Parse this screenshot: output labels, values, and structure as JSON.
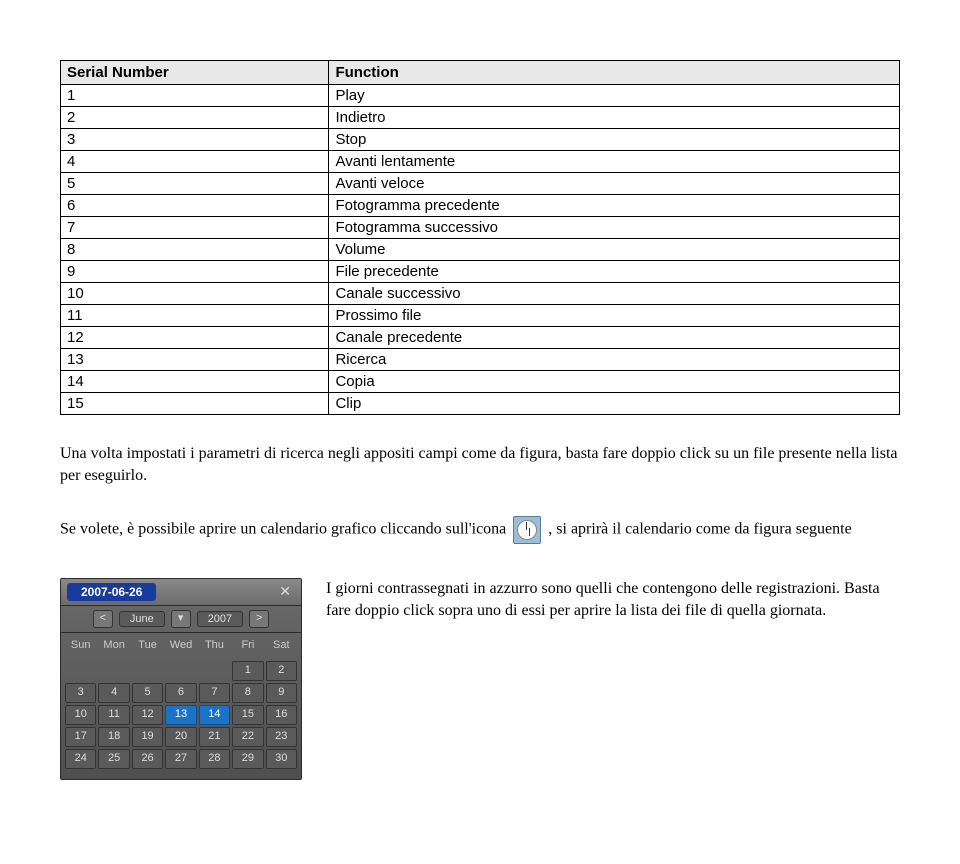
{
  "table": {
    "headers": {
      "serial": "Serial Number",
      "function": "Function"
    },
    "rows": [
      {
        "sn": "1",
        "fn": "Play"
      },
      {
        "sn": "2",
        "fn": "Indietro"
      },
      {
        "sn": "3",
        "fn": "Stop"
      },
      {
        "sn": "4",
        "fn": "Avanti lentamente"
      },
      {
        "sn": "5",
        "fn": "Avanti veloce"
      },
      {
        "sn": "6",
        "fn": "Fotogramma precedente"
      },
      {
        "sn": "7",
        "fn": "Fotogramma successivo"
      },
      {
        "sn": "8",
        "fn": "Volume"
      },
      {
        "sn": "9",
        "fn": "File precedente"
      },
      {
        "sn": "10",
        "fn": "Canale successivo"
      },
      {
        "sn": "11",
        "fn": "Prossimo file"
      },
      {
        "sn": "12",
        "fn": "Canale precedente"
      },
      {
        "sn": "13",
        "fn": "Ricerca"
      },
      {
        "sn": "14",
        "fn": "Copia"
      },
      {
        "sn": "15",
        "fn": "Clip"
      }
    ]
  },
  "para1": "Una volta impostati i parametri di ricerca negli appositi campi come da figura, basta fare doppio click su un file presente nella lista per eseguirlo.",
  "para2_a": "Se volete, è possibile aprire un calendario grafico cliccando sull'icona ",
  "para2_b": ", si aprirà il calendario come da figura seguente",
  "calendar": {
    "date": "2007-06-26",
    "month": "June",
    "year": "2007",
    "dow": [
      "Sun",
      "Mon",
      "Tue",
      "Wed",
      "Thu",
      "Fri",
      "Sat"
    ],
    "cells": [
      "",
      "",
      "",
      "",
      "",
      "1",
      "2",
      "3",
      "4",
      "5",
      "6",
      "7",
      "8",
      "9",
      "10",
      "11",
      "12",
      "13",
      "14",
      "15",
      "16",
      "17",
      "18",
      "19",
      "20",
      "21",
      "22",
      "23",
      "24",
      "25",
      "26",
      "27",
      "28",
      "29",
      "30"
    ],
    "rec_days": [
      "13",
      "14"
    ]
  },
  "side_text": "I giorni contrassegnati in azzurro sono quelli che contengono delle registrazioni. Basta fare doppio click sopra uno di essi per aprire la lista dei file di quella giornata."
}
